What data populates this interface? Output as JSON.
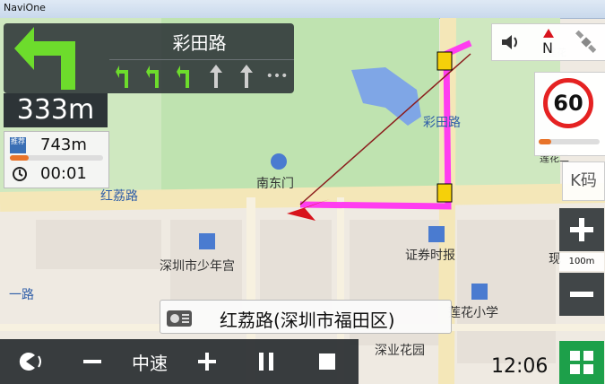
{
  "window": {
    "title": "NaviOne"
  },
  "guidance": {
    "next_road": "彩田路",
    "distance_to_turn": "333m",
    "lanes": [
      "turn-left-arrow-icon",
      "turn-left-arrow-icon",
      "turn-left-arrow-icon",
      "straight-arrow-icon",
      "straight-arrow-icon",
      "more-dots-icon"
    ],
    "remaining_distance": "743m",
    "remaining_time": "00:01",
    "recommend_tag": "推荐"
  },
  "speed_limit": {
    "value": "60"
  },
  "buttons": {
    "k_label": "K码",
    "speed_label": "中速",
    "scale": "100m",
    "top_letter": "N"
  },
  "current_road": "红荔路(深圳市福田区)",
  "clock": "12:06",
  "map_labels": {
    "hongli_road": "红荔路",
    "caitian_road_1": "彩田路",
    "nandongmen": "南东门",
    "children_palace": "深圳市少年宫",
    "securities_times": "证券时报",
    "lianhua_school": "莲花小学",
    "shenye_garden": "深业花园",
    "yilu": "一路",
    "xian": "现",
    "ehuang": "莲花二",
    "ehua": "莲花"
  },
  "colors": {
    "route": "#ff3df0",
    "accent": "#1da04a",
    "panel": "#2d3437"
  }
}
